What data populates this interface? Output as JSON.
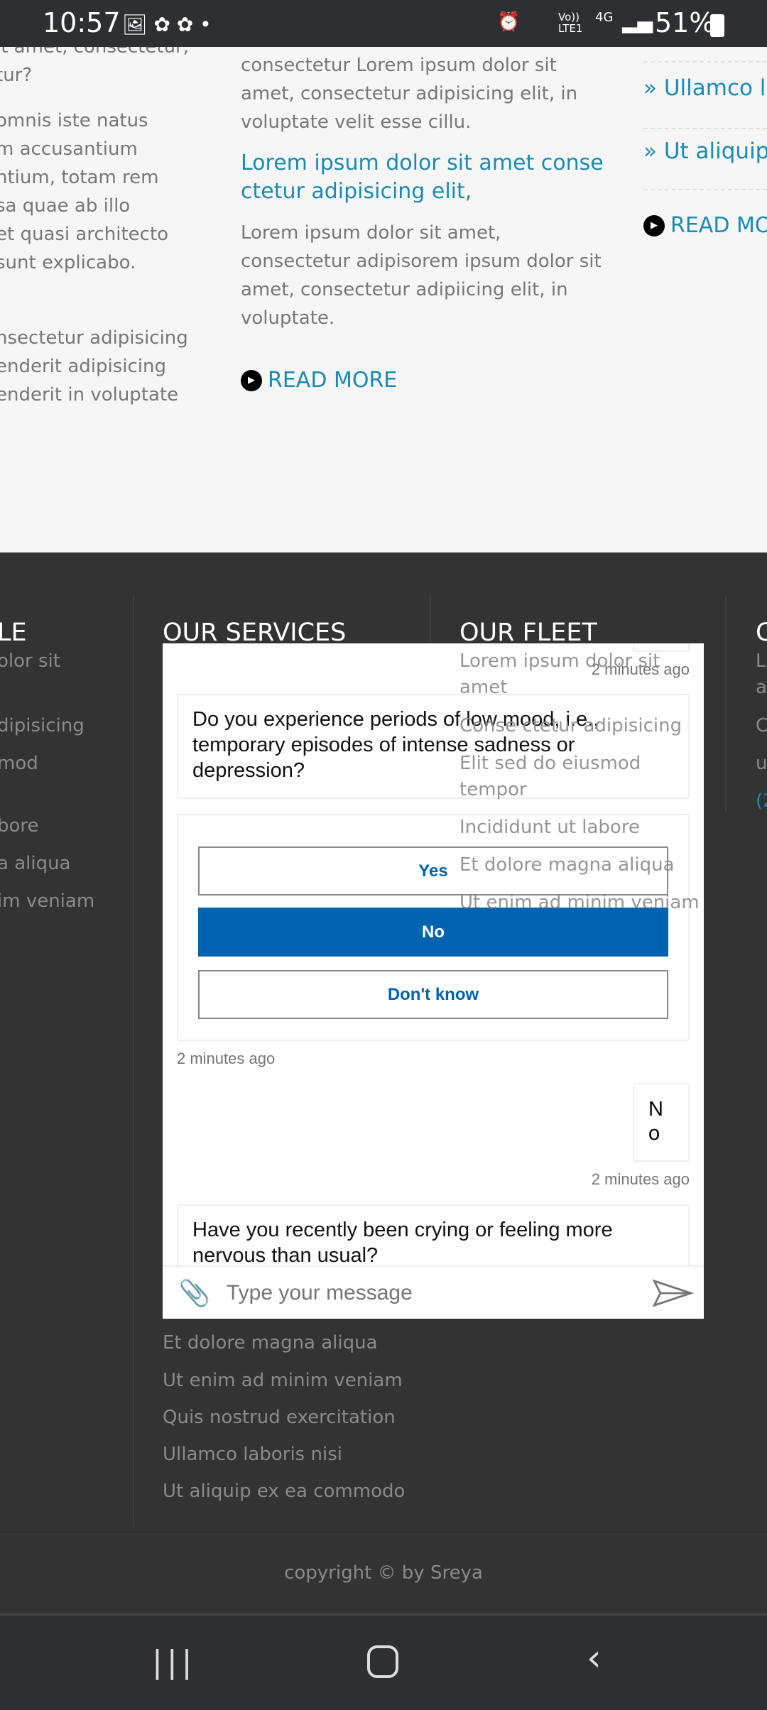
{
  "status": {
    "time": "10:57",
    "battery": "51%",
    "network": "4G",
    "volte": "Vo)) LTE1"
  },
  "content": {
    "left_lines": [
      "it amet, consectetur,",
      "tur?",
      "omnis iste natus",
      "m accusantium",
      "ntium, totam rem",
      "sa quae ab illo",
      "et quasi architecto",
      "sunt explicabo.",
      "nsectetur adipisicing",
      "enderit adipisicing",
      "enderit in voluptate"
    ],
    "middle": {
      "intro_lines": [
        "consectetur Lorem ipsum dolor sit",
        "amet, consectetur adipisicing elit, in",
        "voluptate velit esse cillu."
      ],
      "heading_lines": [
        "Lorem ipsum dolor sit amet conse",
        "ctetur adipisicing elit,"
      ],
      "body_lines": [
        "Lorem ipsum dolor sit amet,",
        "consectetur adipisorem ipsum dolor sit",
        "amet, consectetur adipiicing elit, in",
        "voluptate."
      ],
      "read_more": "READ MORE"
    },
    "right": {
      "links": [
        "Ullamco la",
        "Ut aliquip"
      ],
      "read_more": "READ MO"
    }
  },
  "footer": {
    "headings": [
      "LE",
      "OUR SERVICES",
      "OUR FLEET",
      "C"
    ],
    "left_items": [
      "olor sit",
      "dipisicing",
      "mod",
      "bore",
      "a aliqua",
      "im veniam"
    ],
    "fleet_items": [
      "Lorem ipsum dolor sit",
      "amet",
      "Conse ctetur adipisicing",
      "Elit sed do eiusmod",
      "tempor",
      "Incididunt ut labore",
      "Et dolore magna aliqua",
      "Ut enim ad minim veniam"
    ],
    "right_items": [
      "L",
      "a",
      "C",
      "u",
      "(2"
    ],
    "services_items": [
      "Et dolore magna aliqua",
      "Ut enim ad minim veniam",
      "Quis nostrud exercitation",
      "Ullamco laboris nisi",
      "Ut aliquip ex ea commodo"
    ],
    "copyright": "copyright © by Sreya"
  },
  "chat": {
    "timestamp": "2 minutes ago",
    "question1": "Do you experience periods of low mood, i.e., temporary episodes of intense sadness or depression?",
    "options": [
      "Yes",
      "No",
      "Don't know"
    ],
    "selected_option": "No",
    "user_reply": "No",
    "question2": "Have you recently been crying or feeling more nervous than usual?",
    "input_placeholder": "Type your message",
    "accent": "#0063b0"
  }
}
